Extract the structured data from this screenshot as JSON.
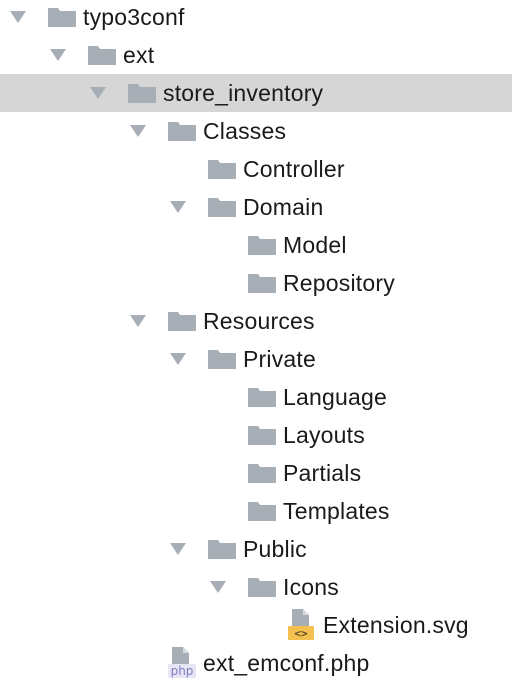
{
  "colors": {
    "folder": "#a7aeb6",
    "chevron": "#a7aeb6",
    "selection": "#d6d6d6",
    "svg_badge": "#f4c04f",
    "svg_badge_glyph": "#5a4a2a",
    "php_badge": "#7e7ebf",
    "php_badge_bg": "#e8e6f6",
    "text": "#1a1a1a"
  },
  "tree": {
    "items": [
      {
        "label": "typo3conf",
        "type": "folder",
        "expanded": true,
        "icon": "folder-icon"
      },
      {
        "label": "ext",
        "type": "folder",
        "expanded": true,
        "icon": "folder-icon"
      },
      {
        "label": "store_inventory",
        "type": "folder",
        "expanded": true,
        "selected": true,
        "icon": "folder-icon"
      },
      {
        "label": "Classes",
        "type": "folder",
        "expanded": true,
        "icon": "folder-icon"
      },
      {
        "label": "Controller",
        "type": "folder",
        "expanded": false,
        "icon": "folder-icon"
      },
      {
        "label": "Domain",
        "type": "folder",
        "expanded": true,
        "icon": "folder-icon"
      },
      {
        "label": "Model",
        "type": "folder",
        "expanded": false,
        "icon": "folder-icon"
      },
      {
        "label": "Repository",
        "type": "folder",
        "expanded": false,
        "icon": "folder-icon"
      },
      {
        "label": "Resources",
        "type": "folder",
        "expanded": true,
        "icon": "folder-icon"
      },
      {
        "label": "Private",
        "type": "folder",
        "expanded": true,
        "icon": "folder-icon"
      },
      {
        "label": "Language",
        "type": "folder",
        "expanded": false,
        "icon": "folder-icon"
      },
      {
        "label": "Layouts",
        "type": "folder",
        "expanded": false,
        "icon": "folder-icon"
      },
      {
        "label": "Partials",
        "type": "folder",
        "expanded": false,
        "icon": "folder-icon"
      },
      {
        "label": "Templates",
        "type": "folder",
        "expanded": false,
        "icon": "folder-icon"
      },
      {
        "label": "Public",
        "type": "folder",
        "expanded": true,
        "icon": "folder-icon"
      },
      {
        "label": "Icons",
        "type": "folder",
        "expanded": true,
        "icon": "folder-icon"
      },
      {
        "label": "Extension.svg",
        "type": "svg-file",
        "icon": "svg-file-icon",
        "badge": "<>"
      },
      {
        "label": "ext_emconf.php",
        "type": "php-file",
        "icon": "php-file-icon",
        "badge": "php"
      }
    ]
  }
}
